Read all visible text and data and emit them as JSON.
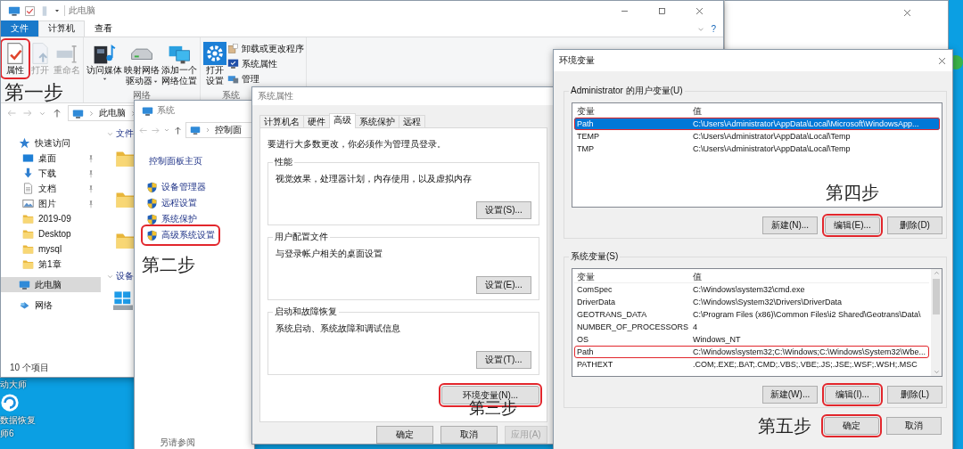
{
  "desktop": {
    "icon_labels": [
      {
        "text": "动大师"
      },
      {
        "text": "数据恢复"
      },
      {
        "text": "师6"
      }
    ]
  },
  "explorer": {
    "title": "此电脑",
    "step_label": "第一步",
    "help": "?",
    "tabs": [
      {
        "label": "文件",
        "kind": "menu",
        "selected": false
      },
      {
        "label": "计算机",
        "kind": "tab",
        "selected": true
      },
      {
        "label": "查看",
        "kind": "tab",
        "selected": false
      }
    ],
    "ribbon_groups": [
      {
        "items": [
          {
            "kind": "properties",
            "lines": [
              "属性"
            ],
            "disabled": false,
            "dropdown": false,
            "highlighted": true
          },
          {
            "kind": "open",
            "lines": [
              "打开"
            ],
            "disabled": true,
            "dropdown": false,
            "highlighted": false
          },
          {
            "kind": "rename",
            "lines": [
              "重命名"
            ],
            "disabled": true,
            "dropdown": false,
            "highlighted": false
          }
        ]
      },
      {
        "label": "网络",
        "items": [
          {
            "kind": "media",
            "lines": [
              "访问媒体"
            ],
            "disabled": false,
            "dropdown": true,
            "highlighted": false
          },
          {
            "kind": "drive",
            "lines": [
              "映射网络",
              "驱动器"
            ],
            "disabled": false,
            "dropdown": true,
            "highlighted": false
          },
          {
            "kind": "netloc",
            "lines": [
              "添加一个",
              "网络位置"
            ],
            "disabled": false,
            "dropdown": false,
            "highlighted": false
          }
        ]
      },
      {
        "label": "系统",
        "items": [
          {
            "kind": "settings",
            "lines": [
              "打开",
              "设置"
            ],
            "disabled": false,
            "dropdown": false,
            "highlighted": false
          }
        ],
        "small_items": [
          {
            "kind": "uninstall",
            "label": "卸载或更改程序"
          },
          {
            "kind": "sysprops",
            "label": "系统属性"
          },
          {
            "kind": "manage",
            "label": "管理"
          }
        ]
      }
    ],
    "address": [
      "此电脑"
    ],
    "sidebar": [
      {
        "label": "快速访问",
        "kind": "star",
        "pinned": false,
        "selected": false,
        "children": [
          {
            "label": "桌面",
            "kind": "desktop",
            "pinned": true,
            "selected": false
          },
          {
            "label": "下载",
            "kind": "download",
            "pinned": true,
            "selected": false
          },
          {
            "label": "文档",
            "kind": "document",
            "pinned": true,
            "selected": false
          },
          {
            "label": "图片",
            "kind": "picture",
            "pinned": true,
            "selected": false
          },
          {
            "label": "2019-09",
            "kind": "folder",
            "pinned": false,
            "selected": false
          },
          {
            "label": "Desktop",
            "kind": "folder",
            "pinned": false,
            "selected": false
          },
          {
            "label": "mysql",
            "kind": "folder",
            "pinned": false,
            "selected": false
          },
          {
            "label": "第1章",
            "kind": "folder",
            "pinned": false,
            "selected": false
          }
        ]
      },
      {
        "label": "此电脑",
        "kind": "pc",
        "pinned": false,
        "selected": true
      },
      {
        "label": "网络",
        "kind": "network",
        "pinned": false,
        "selected": false
      }
    ],
    "sections": [
      {
        "label": "文件"
      },
      {
        "label": "设备"
      }
    ],
    "status_bar": "10 个项目"
  },
  "system_window": {
    "title": "系统",
    "address": [
      "控制面"
    ],
    "home_link": "控制面板主页",
    "links": [
      {
        "label": "设备管理器",
        "highlighted": false
      },
      {
        "label": "远程设置",
        "highlighted": false
      },
      {
        "label": "系统保护",
        "highlighted": false
      },
      {
        "label": "高级系统设置",
        "highlighted": true
      }
    ],
    "step_label": "第二步",
    "see_also": "另请参阅"
  },
  "system_properties": {
    "title": "系统属性",
    "tabs": [
      {
        "label": "计算机名",
        "selected": false
      },
      {
        "label": "硬件",
        "selected": false
      },
      {
        "label": "高级",
        "selected": true
      },
      {
        "label": "系统保护",
        "selected": false
      },
      {
        "label": "远程",
        "selected": false
      }
    ],
    "notice": "要进行大多数更改，你必须作为管理员登录。",
    "groups": [
      {
        "title": "性能",
        "description": "视觉效果，处理器计划，内存使用，以及虚拟内存",
        "button": "设置(S)..."
      },
      {
        "title": "用户配置文件",
        "description": "与登录帐户相关的桌面设置",
        "button": "设置(E)..."
      },
      {
        "title": "启动和故障恢复",
        "description": "系统启动、系统故障和调试信息",
        "button": "设置(T)..."
      }
    ],
    "env_button": {
      "label": "环境变量(N)...",
      "highlighted": true
    },
    "step_label": "第三步",
    "footer_buttons": [
      {
        "label": "确定",
        "disabled": false
      },
      {
        "label": "取消",
        "disabled": false
      },
      {
        "label": "应用(A)",
        "disabled": true
      }
    ]
  },
  "environment_variables": {
    "title": "环境变量",
    "user_vars": {
      "label": "Administrator 的用户变量(U)",
      "columns": [
        "变量",
        "值"
      ],
      "rows": [
        {
          "name": "Path",
          "value": "C:\\Users\\Administrator\\AppData\\Local\\Microsoft\\WindowsApp...",
          "selected": true,
          "highlighted": true
        },
        {
          "name": "TEMP",
          "value": "C:\\Users\\Administrator\\AppData\\Local\\Temp",
          "selected": false,
          "highlighted": false
        },
        {
          "name": "TMP",
          "value": "C:\\Users\\Administrator\\AppData\\Local\\Temp",
          "selected": false,
          "highlighted": false
        }
      ],
      "buttons": [
        {
          "label": "新建(N)...",
          "highlighted": false
        },
        {
          "label": "编辑(E)...",
          "highlighted": true
        },
        {
          "label": "删除(D)",
          "highlighted": false
        }
      ],
      "step_label": "第四步"
    },
    "system_vars": {
      "label": "系统变量(S)",
      "columns": [
        "变量",
        "值"
      ],
      "rows": [
        {
          "name": "ComSpec",
          "value": "C:\\Windows\\system32\\cmd.exe",
          "selected": false,
          "highlighted": false
        },
        {
          "name": "DriverData",
          "value": "C:\\Windows\\System32\\Drivers\\DriverData",
          "selected": false,
          "highlighted": false
        },
        {
          "name": "GEOTRANS_DATA",
          "value": "C:\\Program Files (x86)\\Common Files\\i2 Shared\\Geotrans\\Data\\",
          "selected": false,
          "highlighted": false
        },
        {
          "name": "NUMBER_OF_PROCESSORS",
          "value": "4",
          "selected": false,
          "highlighted": false
        },
        {
          "name": "OS",
          "value": "Windows_NT",
          "selected": false,
          "highlighted": false
        },
        {
          "name": "Path",
          "value": "C:\\Windows\\system32;C:\\Windows;C:\\Windows\\System32\\Wbe...",
          "selected": false,
          "highlighted": true
        },
        {
          "name": "PATHEXT",
          "value": ".COM;.EXE;.BAT;.CMD;.VBS;.VBE;.JS;.JSE;.WSF;.WSH;.MSC",
          "selected": false,
          "highlighted": false
        }
      ],
      "buttons": [
        {
          "label": "新建(W)...",
          "highlighted": false
        },
        {
          "label": "编辑(I)...",
          "highlighted": true
        },
        {
          "label": "删除(L)",
          "highlighted": false
        }
      ]
    },
    "step_label": "第五步",
    "footer_buttons": [
      {
        "label": "确定",
        "highlighted": true
      },
      {
        "label": "取消",
        "highlighted": false
      }
    ]
  }
}
